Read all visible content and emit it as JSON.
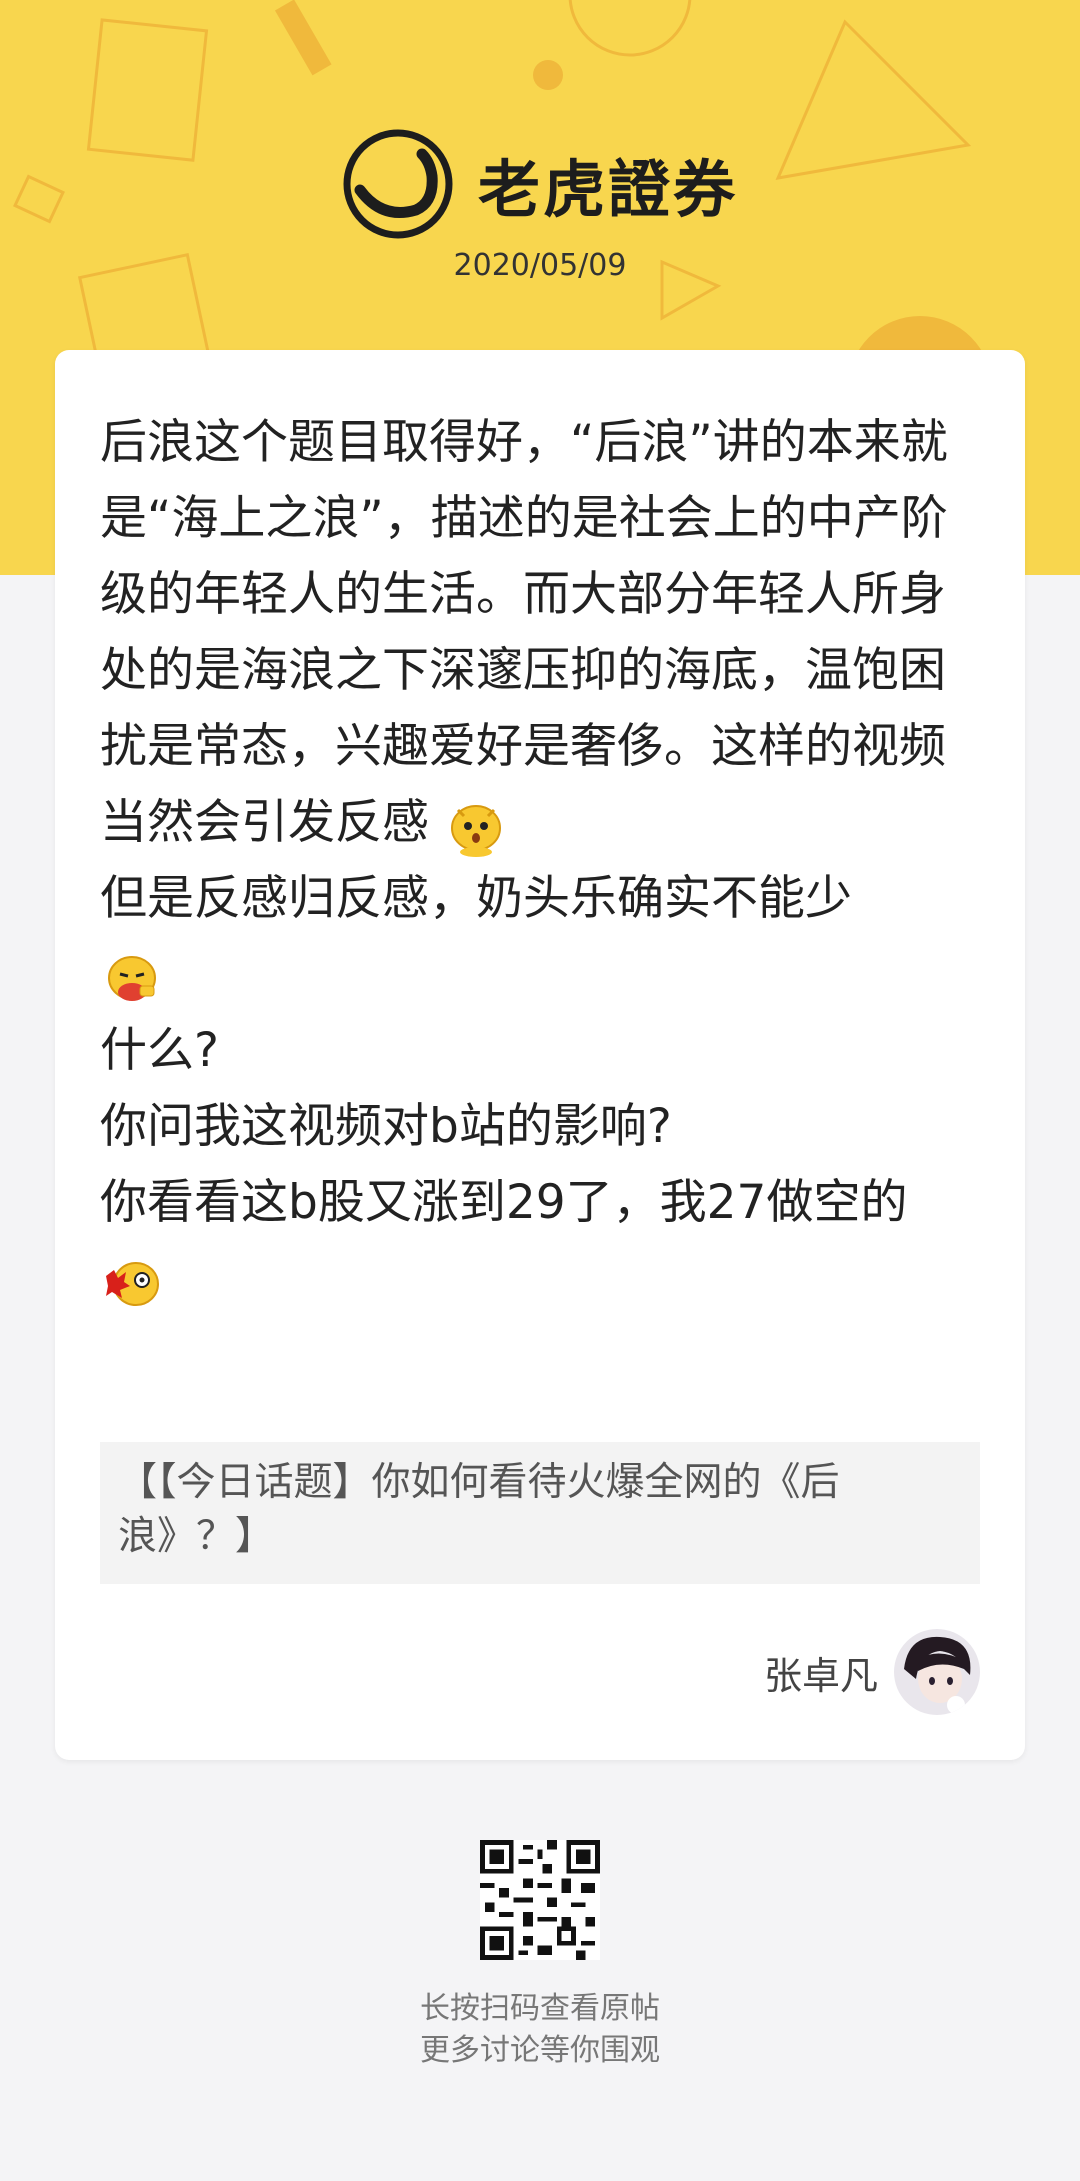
{
  "header": {
    "brand": "老虎證券",
    "date": "2020/05/09",
    "background_color": "#f8d64e",
    "logo_icon": "tiger-stripes-icon"
  },
  "post": {
    "paragraphs": [
      "后浪这个题目取得好，“后浪”讲的本来就是“海上之浪”，描述的是社会上的中产阶级的年轻人的生活。而大部分年轻人所身处的是海浪之下深邃压抑的海底，温饱困扰是常态，兴趣爱好是奢侈。这样的视频当然会引发反感",
      "但是反感归反感，奶头乐确实不能少",
      "什么?",
      "你问我这视频对b站的影响?",
      "你看看这b股又涨到29了，我27做空的"
    ],
    "emojis": [
      "tiger-shocked-emoji",
      "tiger-eating-emoji",
      "tiger-bleeding-emoji"
    ]
  },
  "topic": {
    "text": "【【今日话题】你如何看待火爆全网的《后浪》？】"
  },
  "author": {
    "name": "张卓凡",
    "avatar_icon": "avatar-anime-girl"
  },
  "footer": {
    "qr_icon": "qr-code-icon",
    "line1": "长按扫码查看原帖",
    "line2": "更多讨论等你围观"
  }
}
